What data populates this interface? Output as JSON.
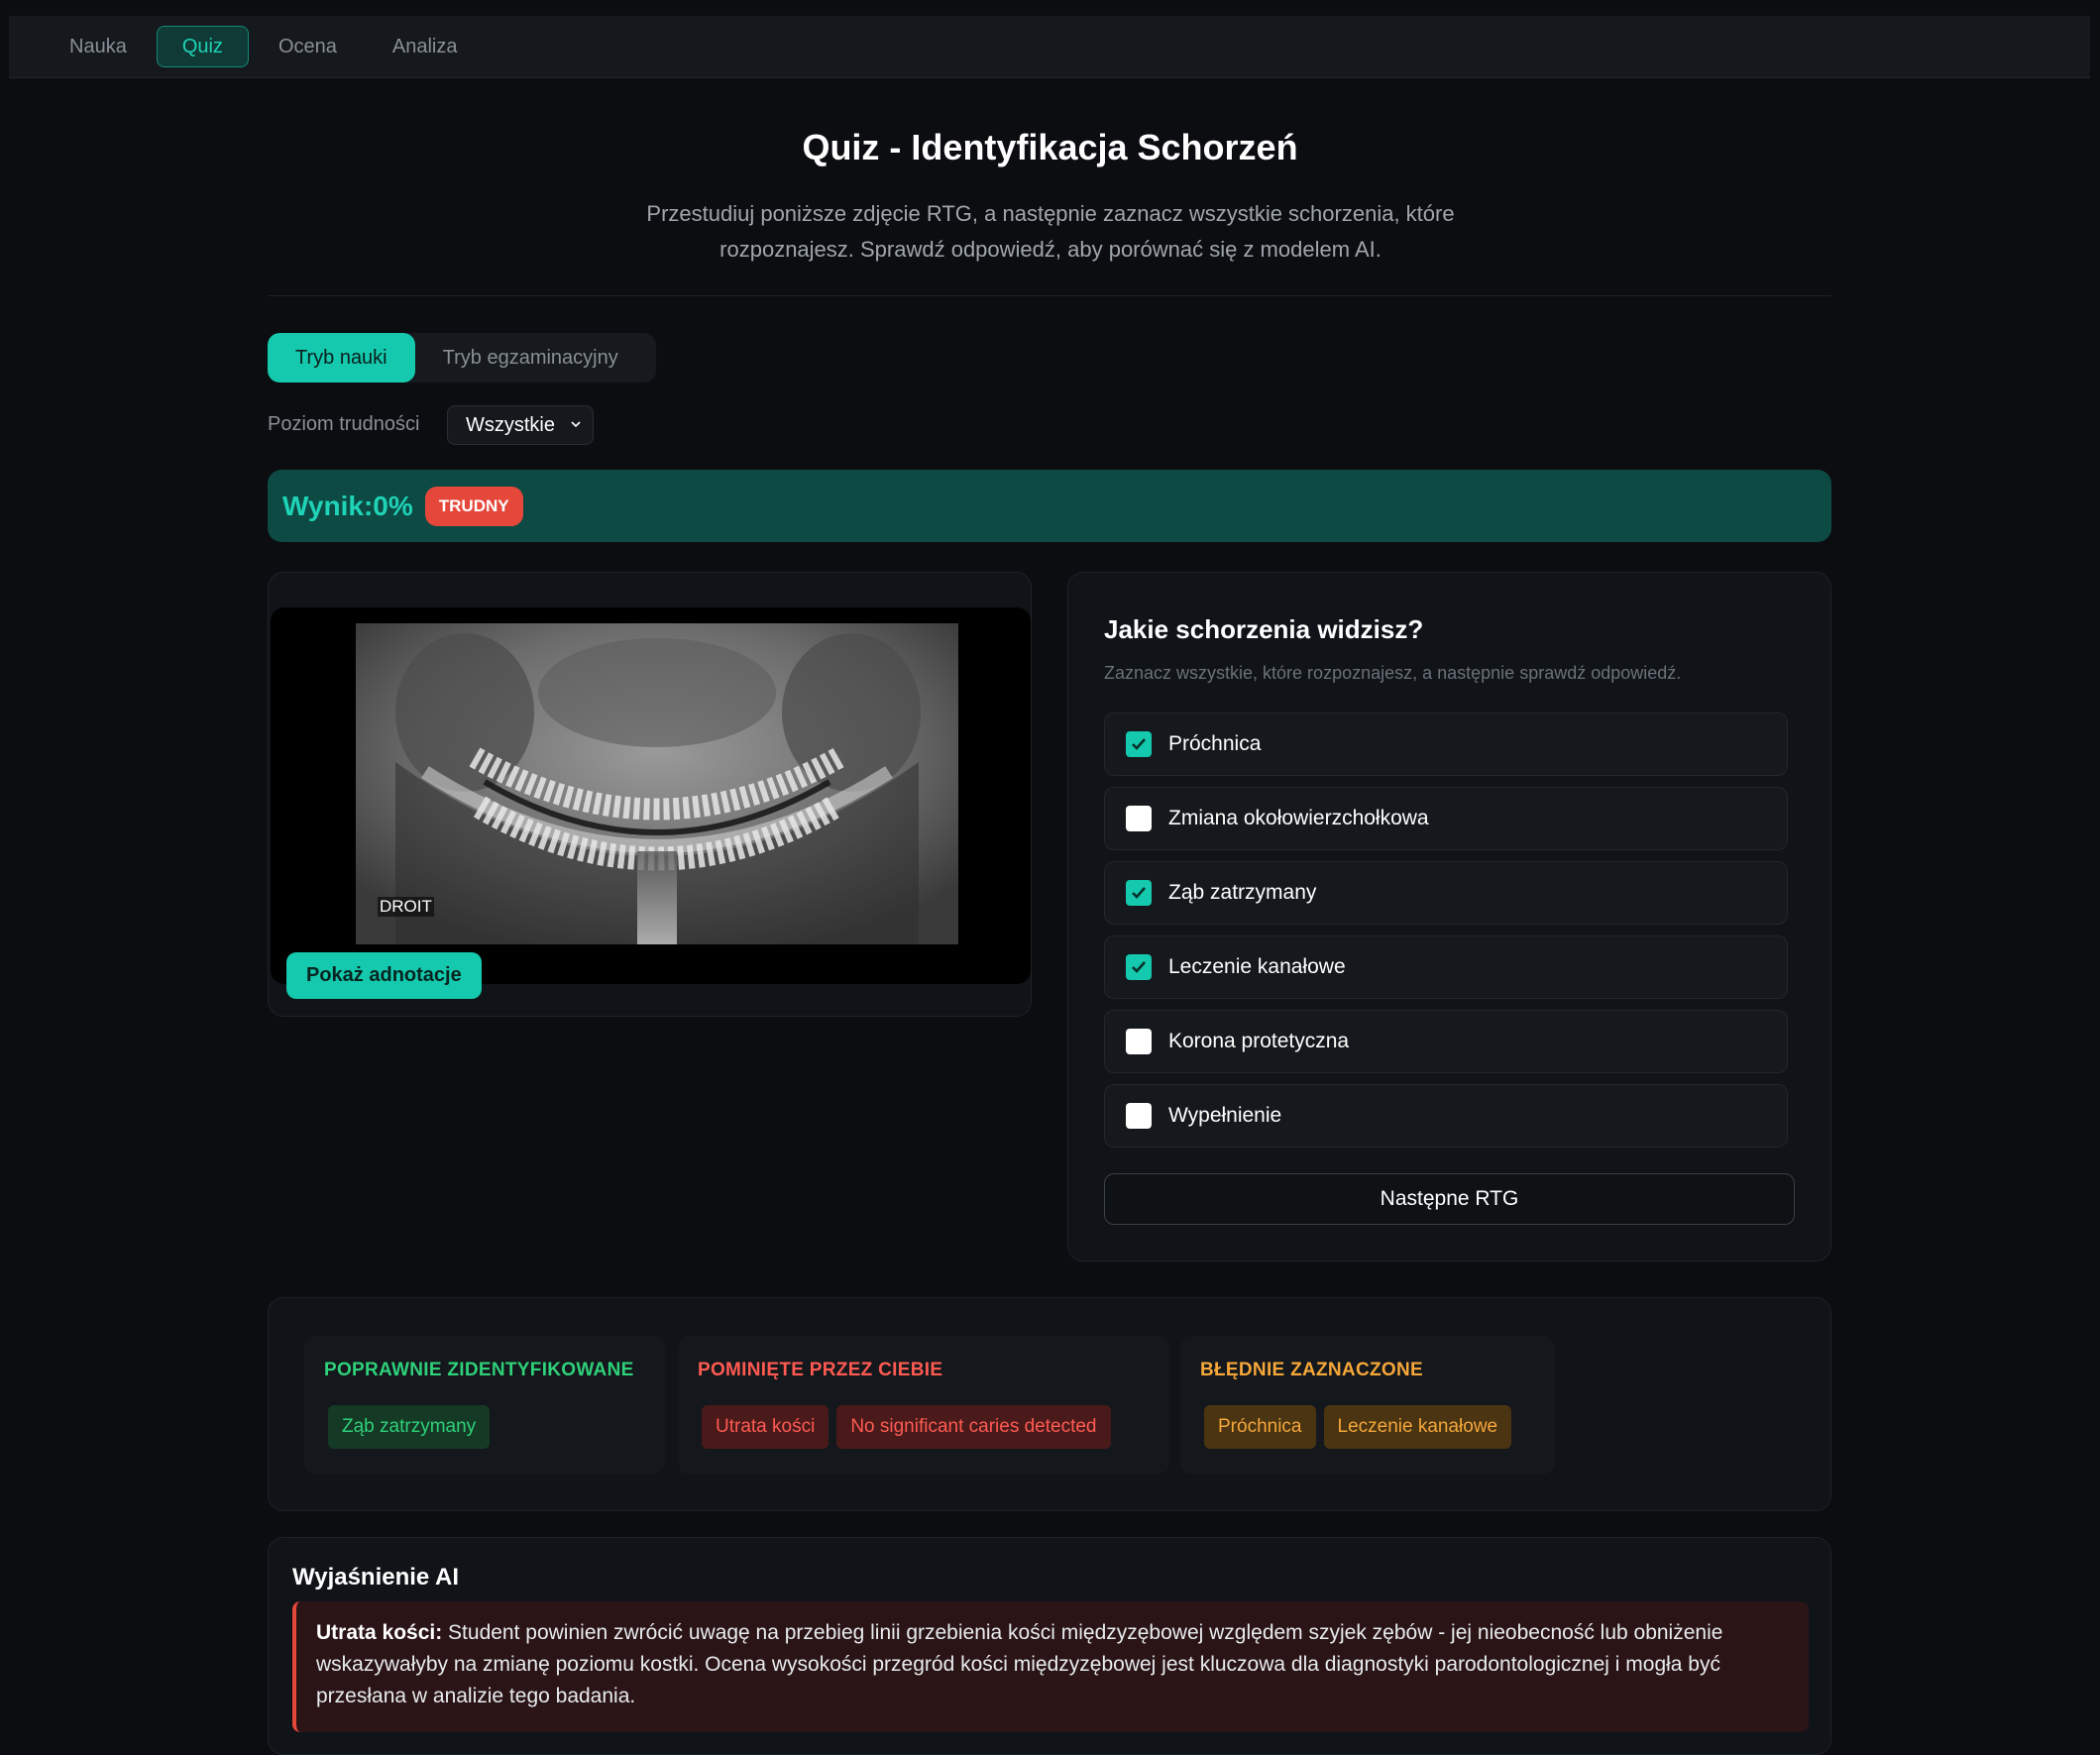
{
  "nav": {
    "tabs": [
      {
        "label": "Nauka",
        "active": false
      },
      {
        "label": "Quiz",
        "active": true
      },
      {
        "label": "Ocena",
        "active": false
      },
      {
        "label": "Analiza",
        "active": false
      }
    ]
  },
  "header": {
    "title": "Quiz - Identyfikacja Schorzeń",
    "description": "Przestudiuj poniższe zdjęcie RTG, a następnie zaznacz wszystkie schorzenia, które rozpoznajesz. Sprawdź odpowiedź, aby porównać się z modelem AI."
  },
  "modes": {
    "learn": "Tryb nauki",
    "exam": "Tryb egzaminacyjny",
    "active": "learn"
  },
  "difficulty": {
    "label": "Poziom trudności",
    "selected": "Wszystkie"
  },
  "score": {
    "text": "Wynik:0%",
    "level_badge": "TRUDNY"
  },
  "xray": {
    "orientation_label": "DROIT",
    "show_annotations_label": "Pokaż adnotacje"
  },
  "question": {
    "title": "Jakie schorzenia widzisz?",
    "subtitle": "Zaznacz wszystkie, które rozpoznajesz, a następnie sprawdź odpowiedź.",
    "options": [
      {
        "label": "Próchnica",
        "checked": true
      },
      {
        "label": "Zmiana okołowierzchołkowa",
        "checked": false
      },
      {
        "label": "Ząb zatrzymany",
        "checked": true
      },
      {
        "label": "Leczenie kanałowe",
        "checked": true
      },
      {
        "label": "Korona protetyczna",
        "checked": false
      },
      {
        "label": "Wypełnienie",
        "checked": false
      }
    ],
    "next_label": "Następne RTG"
  },
  "results": {
    "correct": {
      "title": "POPRAWNIE ZIDENTYFIKOWANE",
      "items": [
        "Ząb zatrzymany"
      ]
    },
    "missed": {
      "title": "POMINIĘTE PRZEZ CIEBIE",
      "items": [
        "Utrata kości",
        "No significant caries detected"
      ]
    },
    "wrong": {
      "title": "BŁĘDNIE ZAZNACZONE",
      "items": [
        "Próchnica",
        "Leczenie kanałowe"
      ]
    }
  },
  "explanation": {
    "title": "Wyjaśnienie AI",
    "term": "Utrata kości:",
    "text": " Student powinien zwrócić uwagę na przebieg linii grzebienia kości międzyzębowej względem szyjek zębów - jej nieobecność lub obniżenie wskazywałyby na zmianę poziomu kostki. Ocena wysokości przegród kości międzyzębowej jest kluczowa dla diagnostyki parodontologicznej i mogła być przesłana w analizie tego badania."
  },
  "colors": {
    "accent": "#14c9ad",
    "danger": "#e5483b",
    "success": "#2fd07a",
    "warning": "#f5a73a"
  }
}
